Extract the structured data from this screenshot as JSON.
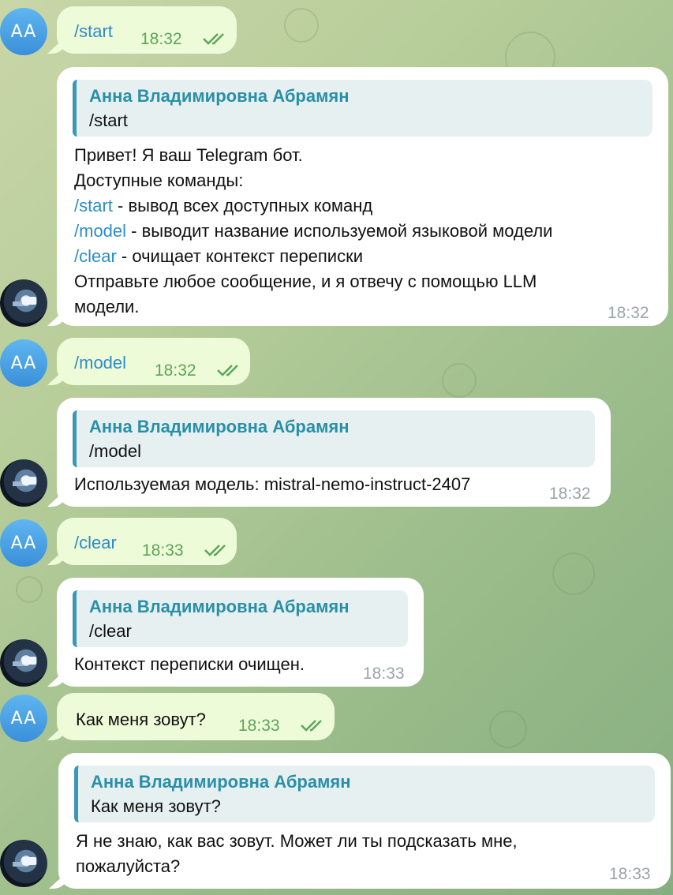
{
  "chat": {
    "user_initials": "AA",
    "bot_avatar_icon": "robot-avatar-icon",
    "messages": [
      {
        "from": "user",
        "text": "/start",
        "time": "18:32",
        "status": "read"
      },
      {
        "from": "bot",
        "reply_to_name": "Анна Владимировна Абрамян",
        "reply_to_text": "/start",
        "lines": [
          "Привет! Я ваш Telegram бот.",
          "Доступные команды:",
          {
            "cmd": "/start",
            "rest": " - вывод всех доступных команд"
          },
          {
            "cmd": "/model",
            "rest": " - выводит название используемой языковой модели"
          },
          {
            "cmd": "/clear",
            "rest": " - очищает контекст переписки"
          },
          "Отправьте любое сообщение, и я отвечу с помощью LLM",
          "модели."
        ],
        "time": "18:32"
      },
      {
        "from": "user",
        "text": "/model",
        "time": "18:32",
        "status": "read"
      },
      {
        "from": "bot",
        "reply_to_name": "Анна Владимировна Абрамян",
        "reply_to_text": "/model",
        "lines": [
          "Используемая модель: mistral-nemo-instruct-2407"
        ],
        "time": "18:32"
      },
      {
        "from": "user",
        "text": "/clear",
        "time": "18:33",
        "status": "read"
      },
      {
        "from": "bot",
        "reply_to_name": "Анна Владимировна Абрамян",
        "reply_to_text": "/clear",
        "lines": [
          "Контекст переписки очищен."
        ],
        "time": "18:33"
      },
      {
        "from": "user",
        "text": "Как меня зовут?",
        "time": "18:33",
        "status": "read"
      },
      {
        "from": "bot",
        "reply_to_name": "Анна Владимировна Абрамян",
        "reply_to_text": "Как меня зовут?",
        "lines": [
          "Я не знаю, как вас зовут. Может ли ты подсказать мне,",
          "пожалуйста?"
        ],
        "time": "18:33"
      }
    ]
  },
  "colors": {
    "outgoing_bubble": "#eefbd8",
    "incoming_bubble": "#ffffff",
    "command_link": "#2d8dc6",
    "reply_name": "#2a8fa8",
    "read_check": "#5aa55a"
  }
}
